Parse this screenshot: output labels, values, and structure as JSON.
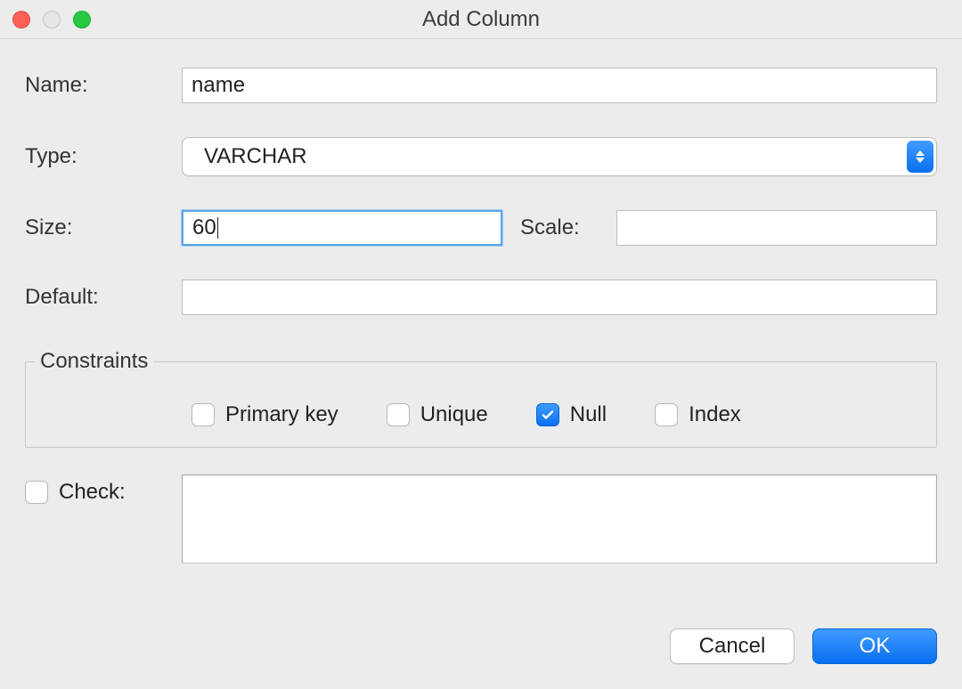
{
  "window": {
    "title": "Add Column"
  },
  "traffic": {
    "close": "#fe5f57",
    "minimize": "#e6e6e6",
    "zoom": "#28c840"
  },
  "labels": {
    "name": "Name:",
    "type": "Type:",
    "size": "Size:",
    "scale": "Scale:",
    "default": "Default:",
    "constraints_legend": "Constraints",
    "check": "Check:"
  },
  "fields": {
    "name_value": "name",
    "type_value": "VARCHAR",
    "size_value": "60",
    "scale_value": "",
    "default_value": "",
    "check_value": ""
  },
  "constraints": {
    "primary_key": {
      "label": "Primary key",
      "checked": false
    },
    "unique": {
      "label": "Unique",
      "checked": false
    },
    "nullable": {
      "label": "Null",
      "checked": true
    },
    "index": {
      "label": "Index",
      "checked": false
    }
  },
  "check_checkbox": {
    "checked": false
  },
  "buttons": {
    "cancel": "Cancel",
    "ok": "OK"
  }
}
